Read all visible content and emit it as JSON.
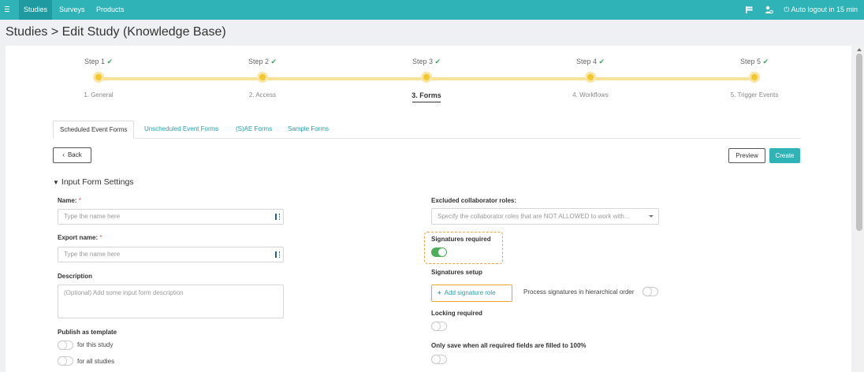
{
  "topbar": {
    "tabs": [
      "Studies",
      "Surveys",
      "Products"
    ],
    "active_tab": "Studies",
    "logout": "Auto logout in 15 min",
    "icons": [
      "menu-icon",
      "flag-icon",
      "user-settings-icon",
      "power-icon"
    ],
    "color": "#2fb3b7"
  },
  "page": {
    "title": "Studies > Edit Study (Knowledge Base)"
  },
  "stepper": {
    "steps": [
      {
        "label": "Step 1",
        "name": "1. General",
        "done": true
      },
      {
        "label": "Step 2",
        "name": "2. Access",
        "done": true
      },
      {
        "label": "Step 3",
        "name": "3. Forms",
        "done": true,
        "active": true
      },
      {
        "label": "Step 4",
        "name": "4. Workflows",
        "done": true
      },
      {
        "label": "Step 5",
        "name": "5. Trigger Events",
        "done": true
      }
    ],
    "check": "✔"
  },
  "tabs": [
    "Scheduled Event Forms",
    "Unscheduled Event Forms",
    "(S)AE Forms",
    "Sample Forms"
  ],
  "active_tab": "Scheduled Event Forms",
  "buttons": {
    "back": "Back",
    "preview": "Preview",
    "create": "Create"
  },
  "section": {
    "title": "Input Form Settings"
  },
  "form": {
    "name_label": "Name:",
    "name_placeholder": "Type the name here",
    "export_label": "Export name:",
    "export_placeholder": "Type the name here",
    "description_label": "Description",
    "description_placeholder": "(Optional) Add some input form description",
    "template_label": "Publish as template",
    "template_this": "for this study",
    "template_all": "for all studies",
    "excluded_label": "Excluded collaborator roles:",
    "excluded_placeholder": "Specify the collaborator roles that are NOT ALLOWED to work with...",
    "signatures_required_label": "Signatures required",
    "signatures_required": true,
    "signatures_setup_label": "Signatures setup",
    "add_signature_role": "Add signature role",
    "hierarchical_label": "Process signatures in hierarchical order",
    "hierarchical": false,
    "locking_label": "Locking required",
    "locking": false,
    "save_complete_label": "Only save when all required fields are filled to 100%",
    "save_complete": false,
    "required_mark": "*"
  },
  "colors": {
    "accent": "#2fb3b7",
    "toggle_on": "#4cae5b",
    "highlight": "#f2a23c",
    "step_dot": "#f6c630"
  }
}
